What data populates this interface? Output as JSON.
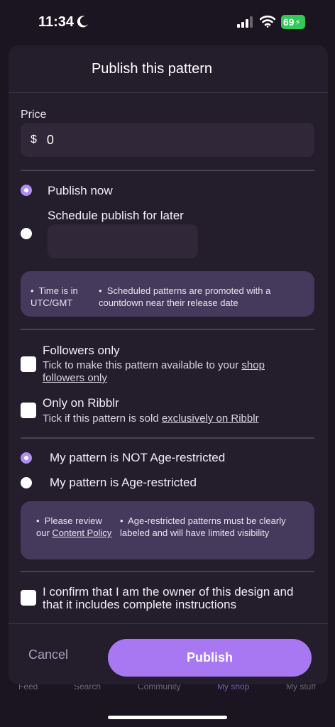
{
  "status_bar": {
    "time": "11:34",
    "battery": "69"
  },
  "background_tabs": [
    "Feed",
    "Search",
    "Community",
    "My shop",
    "My stuff"
  ],
  "sheet": {
    "title": "Publish this pattern",
    "price": {
      "label": "Price",
      "currency": "$",
      "value": "0"
    },
    "publish_options": {
      "now_label": "Publish now",
      "later_label": "Schedule publish for later",
      "selected": "now"
    },
    "schedule_info": {
      "bullet1": "Time is in UTC/GMT",
      "bullet2": "Scheduled patterns are promoted with a countdown near their release date"
    },
    "followers_only": {
      "title": "Followers only",
      "desc_prefix": "Tick to make this pattern available to your ",
      "desc_link": "shop followers only",
      "checked": false
    },
    "only_on_ribblr": {
      "title": "Only on Ribblr",
      "desc_prefix": "Tick if this pattern is sold ",
      "desc_link": "exclusively on Ribblr",
      "checked": false
    },
    "age_options": {
      "not_restricted_label": "My pattern is NOT Age-restricted",
      "restricted_label": "My pattern is Age-restricted",
      "selected": "not_restricted"
    },
    "age_info": {
      "bullet1_prefix": "Please review our ",
      "bullet1_link": "Content Policy",
      "bullet2": "Age-restricted patterns must be clearly labeled and will have limited visibility"
    },
    "confirm": {
      "text": "I confirm that I am the owner of this design and that it includes complete instructions",
      "checked": false
    },
    "cancel_label": "Cancel",
    "publish_label": "Publish"
  },
  "colors": {
    "accent": "#a877f2",
    "sheet_bg": "#231d2c",
    "info_bg": "#463a5c"
  }
}
